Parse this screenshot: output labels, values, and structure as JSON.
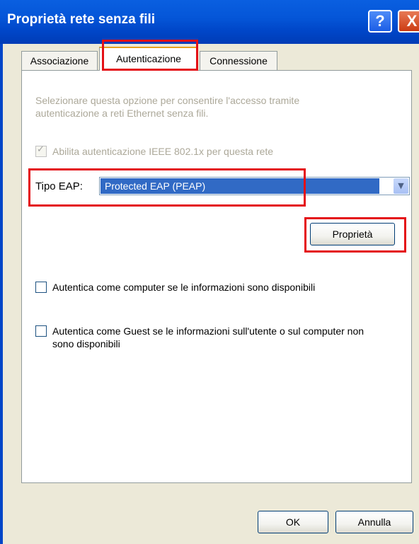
{
  "window": {
    "title": "Proprietà rete senza fili",
    "help_glyph": "?",
    "close_glyph": "X"
  },
  "tabs": [
    {
      "label": "Associazione",
      "active": false
    },
    {
      "label": "Autenticazione",
      "active": true
    },
    {
      "label": "Connessione",
      "active": false
    }
  ],
  "panel": {
    "description": "Selezionare questa opzione per consentire l'accesso tramite autenticazione a reti Ethernet senza fili.",
    "enable_8021x": {
      "label": "Abilita autenticazione IEEE 802.1x per questa rete",
      "checked": true,
      "disabled": true
    },
    "eap": {
      "label": "Tipo EAP:",
      "selected": "Protected EAP (PEAP)"
    },
    "properties_button": "Proprietà",
    "auth_computer": {
      "label": "Autentica come computer se le informazioni sono disponibili",
      "checked": false
    },
    "auth_guest": {
      "label": "Autentica come Guest se le informazioni sull'utente o sul computer non sono disponibili",
      "checked": false
    }
  },
  "footer": {
    "ok_label": "OK",
    "cancel_label": "Annulla"
  },
  "colors": {
    "highlight": "#e41016",
    "titlebar": "#0556d8",
    "selection": "#316ac5"
  }
}
